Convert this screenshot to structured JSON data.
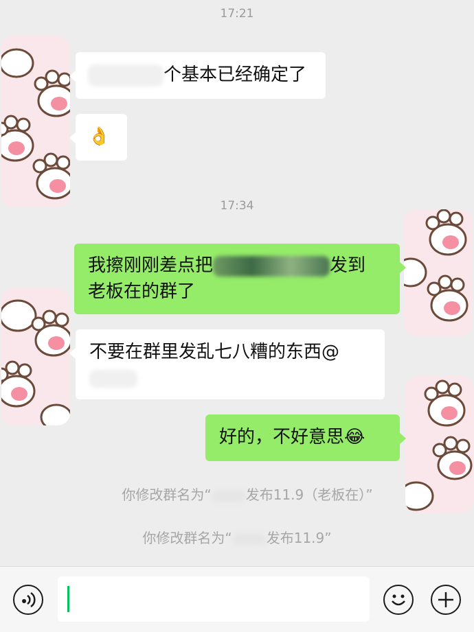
{
  "chat": {
    "time_1": "17:21",
    "time_2": "17:34",
    "msg_1_text": "个基本已经确定了",
    "msg_2_emoji": "👌",
    "msg_3_prefix": "我擦刚刚差点把",
    "msg_3_suffix": "发到",
    "msg_3_line2": "老板在的群了",
    "msg_4_line1": "不要在群里发乱七八糟的东西@",
    "msg_5_text": "好的，不好意思",
    "msg_5_emoji": "😂",
    "sys_1_prefix": "你修改群名为“",
    "sys_1_suffix": "发布11.9（老板在）”",
    "sys_2_prefix": "你修改群名为“",
    "sys_2_suffix": "发布11.9”"
  },
  "colors": {
    "background": "#ededed",
    "incoming_bubble": "#ffffff",
    "outgoing_bubble": "#95ec69",
    "cursor": "#07c160"
  },
  "icons": [
    "voice-icon",
    "emoji-icon",
    "plus-icon"
  ]
}
